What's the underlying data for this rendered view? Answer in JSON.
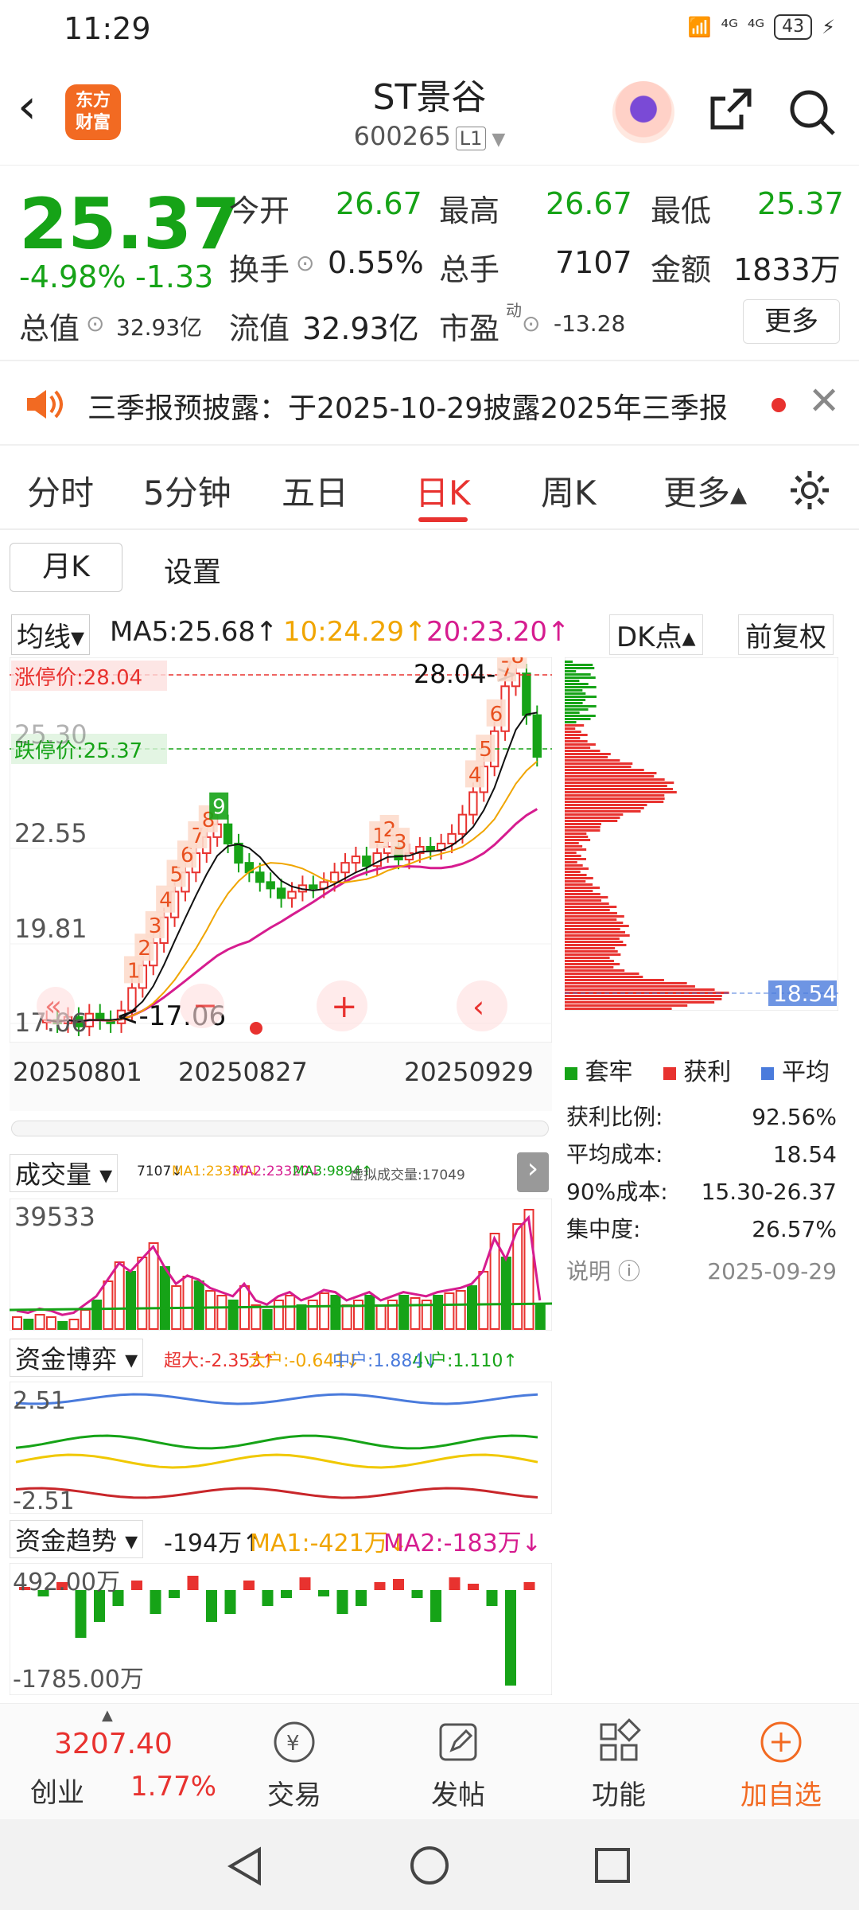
{
  "status": {
    "time": "11:29",
    "signal1": "⁴ᴳ",
    "signal2": "⁴ᴳ",
    "battery": "43"
  },
  "header": {
    "title": "ST景谷",
    "code": "600265",
    "level": "L1",
    "logo_line1": "东方",
    "logo_line2": "财富"
  },
  "quote": {
    "price": "25.37",
    "change_pct": "-4.98%",
    "change": "-1.33",
    "open_label": "今开",
    "open": "26.67",
    "high_label": "最高",
    "high": "26.67",
    "low_label": "最低",
    "low": "25.37",
    "turnover_label": "换手",
    "turnover": "0.55%",
    "volume_label": "总手",
    "volume": "7107",
    "amount_label": "金额",
    "amount": "1833万",
    "mktcap_label": "总值",
    "mktcap": "32.93亿",
    "float_label": "流值",
    "float": "32.93亿",
    "pe_label": "市盈",
    "pe_sup": "动",
    "pe": "-13.28",
    "more": "更多"
  },
  "notice": {
    "text": "三季报预披露：于2025-10-29披露2025年三季报"
  },
  "tabs": [
    "分时",
    "5分钟",
    "五日",
    "日K",
    "周K",
    "更多▴"
  ],
  "subtabs": {
    "monthk": "月K",
    "settings": "设置"
  },
  "ma": {
    "selector": "均线▾",
    "ma5": "MA5:25.68↑",
    "ma10": "10:24.29↑",
    "ma20": "20:23.20↑",
    "dk": "DK点▴",
    "fq": "前复权"
  },
  "kchart": {
    "limit_up": "涨停价:28.04",
    "limit_down": "跌停价:25.37",
    "y1": "25.30",
    "y2": "22.55",
    "y3": "19.81",
    "y4": "17.06",
    "high_mark": "28.04->",
    "low_mark": "<-17.06",
    "d1": "20250801",
    "d2": "20250827",
    "d3": "20250929",
    "tags": [
      "1",
      "2",
      "3",
      "4",
      "5",
      "6",
      "7",
      "8",
      "9",
      "1",
      "2",
      "3",
      "4",
      "5",
      "6",
      "7",
      "8"
    ]
  },
  "chips": {
    "avg": "18.54",
    "legend_trap": "套牢",
    "legend_profit": "获利",
    "legend_avg": "平均",
    "rows": [
      {
        "k": "获利比例:",
        "v": "92.56%"
      },
      {
        "k": "平均成本:",
        "v": "18.54"
      },
      {
        "k": "90%成本:",
        "v": "15.30-26.37"
      },
      {
        "k": "集中度:",
        "v": "26.57%"
      }
    ],
    "note": "说明",
    "date": "2025-09-29"
  },
  "vol": {
    "label": "成交量 ▾",
    "info1": "7107↓",
    "info2": "MA1:23320↓",
    "info3": "MA2:23320↓",
    "info4": "MA3:9894↑",
    "info5": "虚拟成交量:17049",
    "ymax": "39533"
  },
  "fund": {
    "label": "资金博弈 ▾",
    "a": "超大:-2.353↑",
    "b": "大户:-0.641↓",
    "c": "中户:1.884↓",
    "d": "小户:1.110↑",
    "ymax": "2.51",
    "ymin": "-2.51"
  },
  "trend": {
    "label": "资金趋势 ▾",
    "v": "-194万↑",
    "ma1": "MA1:-421万↓",
    "ma2": "MA2:-183万↓",
    "ymax": "492.00万",
    "ymin": "-1785.00万"
  },
  "bottom": {
    "index_val": "3207.40",
    "index_name": "创业",
    "index_pct": "1.77%",
    "trade": "交易",
    "post": "发帖",
    "func": "功能",
    "add": "加自选"
  }
}
